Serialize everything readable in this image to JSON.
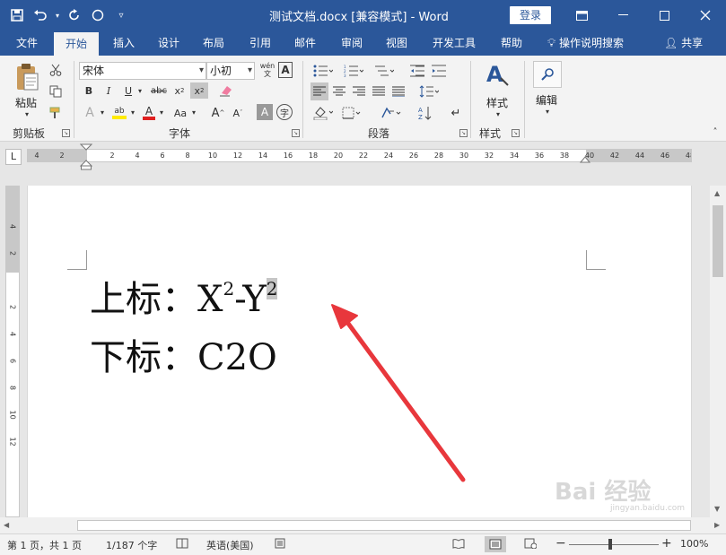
{
  "titlebar": {
    "doc_title": "测试文档.docx [兼容模式]  -  Word",
    "login_label": "登录",
    "bg_color": "#2b579a"
  },
  "tabs": [
    {
      "label": "文件"
    },
    {
      "label": "开始"
    },
    {
      "label": "插入"
    },
    {
      "label": "设计"
    },
    {
      "label": "布局"
    },
    {
      "label": "引用"
    },
    {
      "label": "邮件"
    },
    {
      "label": "审阅"
    },
    {
      "label": "视图"
    },
    {
      "label": "开发工具"
    },
    {
      "label": "帮助"
    }
  ],
  "tell_me": "操作说明搜索",
  "share": "共享",
  "ribbon": {
    "clipboard": {
      "paste_label": "粘贴",
      "group_label": "剪贴板"
    },
    "font": {
      "font_name": "宋体",
      "font_size": "小初",
      "group_label": "字体",
      "phonetic_label": "wén"
    },
    "paragraph": {
      "group_label": "段落"
    },
    "styles": {
      "label": "样式",
      "group_label": "样式"
    },
    "editing": {
      "label": "编辑"
    }
  },
  "ruler": {
    "corner": "L",
    "h_left": [
      "4",
      "2"
    ],
    "h_marks": [
      "2",
      "4",
      "6",
      "8",
      "10",
      "12",
      "14",
      "16",
      "18",
      "20",
      "22",
      "24",
      "26",
      "28",
      "30",
      "32",
      "34",
      "36",
      "38"
    ],
    "h_right": [
      "40",
      "42",
      "44",
      "46",
      "48"
    ],
    "v_top": [
      "4",
      "2"
    ],
    "v_marks": [
      "2",
      "4",
      "6",
      "8",
      "10",
      "12"
    ]
  },
  "document": {
    "line1_prefix": "上标：X",
    "line1_sup1": "2",
    "line1_mid": "-Y",
    "line1_sup2": "2",
    "line2": "下标：C2O"
  },
  "statusbar": {
    "page": "第 1 页，共 1 页",
    "words": "1/187 个字",
    "language": "英语(美国)",
    "zoom": "100%",
    "zoom_minus": "−",
    "zoom_plus": "+"
  },
  "watermark": {
    "text": "Bai 经验",
    "sub": "jingyan.baidu.com"
  }
}
